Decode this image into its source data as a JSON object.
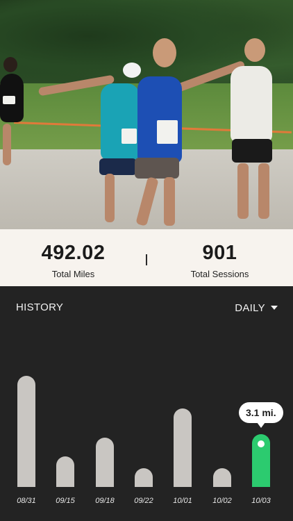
{
  "stats": {
    "total_miles_value": "492.02",
    "total_miles_label": "Total Miles",
    "total_sessions_value": "901",
    "total_sessions_label": "Total Sessions"
  },
  "history": {
    "title": "HISTORY",
    "period_label": "DAILY",
    "selected_tooltip": "3.1 mi."
  },
  "colors": {
    "accent": "#2ccb6f",
    "bar": "#c9c6c2",
    "panel_bg": "#232323",
    "stats_bg": "#f7f3ee"
  },
  "chart_data": {
    "type": "bar",
    "categories": [
      "08/31",
      "09/15",
      "09/18",
      "09/22",
      "10/01",
      "10/02",
      "10/03"
    ],
    "values": [
      6.5,
      1.8,
      2.9,
      1.1,
      4.6,
      1.1,
      3.1
    ],
    "selected_index": 6,
    "ylim": [
      0,
      7
    ],
    "xlabel": "",
    "ylabel": ""
  }
}
